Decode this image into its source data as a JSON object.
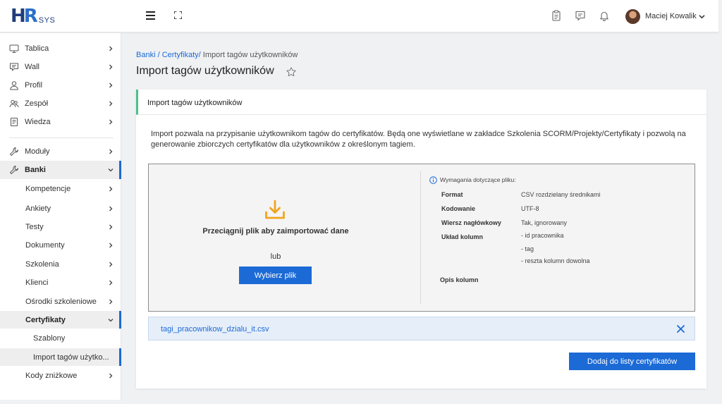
{
  "header": {
    "logo_main": "HR",
    "logo_sub": "SYS",
    "user_name": "Maciej Kowalik",
    "icons": [
      "menu-icon",
      "fullscreen-icon",
      "clipboard-icon",
      "chat-icon",
      "bell-icon",
      "chevron-down-icon"
    ]
  },
  "sidebar": {
    "items": [
      {
        "label": "Tablica",
        "icon": "monitor-icon"
      },
      {
        "label": "Wall",
        "icon": "chat-icon"
      },
      {
        "label": "Profil",
        "icon": "user-icon"
      },
      {
        "label": "Zespół",
        "icon": "team-icon"
      },
      {
        "label": "Wiedza",
        "icon": "book-icon"
      },
      {
        "label": "Moduły",
        "icon": "wrench-icon"
      },
      {
        "label": "Banki",
        "icon": "wrench-icon"
      },
      {
        "label": "Kompetencje"
      },
      {
        "label": "Ankiety"
      },
      {
        "label": "Testy"
      },
      {
        "label": "Dokumenty"
      },
      {
        "label": "Szkolenia"
      },
      {
        "label": "Klienci"
      },
      {
        "label": "Ośrodki szkoleniowe"
      },
      {
        "label": "Certyfikaty"
      },
      {
        "label": "Szablony"
      },
      {
        "label": "Import tagów użytko..."
      },
      {
        "label": "Kody zniżkowe"
      }
    ]
  },
  "breadcrumb": {
    "part1": "Banki",
    "sep1": " / ",
    "part2": "Certyfikaty",
    "sep2": "/ ",
    "current": "Import tagów użytkowników"
  },
  "page": {
    "title": "Import tagów użytkowników"
  },
  "card": {
    "header": "Import tagów użytkowników",
    "description": "Import pozwala na przypisanie użytkownikom tagów do certyfikatów. Będą one wyświetlane w zakładce Szkolenia SCORM/Projekty/Certyfikaty i pozwolą na generowanie zbiorczych certyfikatów dla użytkowników z określonym tagiem.",
    "drop": {
      "drag_text": "Przeciągnij plik aby zaimportować dane",
      "or_text": "lub",
      "choose_label": "Wybierz plik"
    },
    "requirements": {
      "title": "Wymagania dotyczące pliku:",
      "rows": [
        {
          "label": "Format",
          "value": "CSV rozdzielany średnikami"
        },
        {
          "label": "Kodowanie",
          "value": "UTF-8"
        },
        {
          "label": "Wiersz nagłówkowy",
          "value": "Tak, ignorowany"
        },
        {
          "label": "Układ kolumn",
          "value": "- id pracownika"
        }
      ],
      "extra_values": [
        "- tag",
        "- reszta kolumn dowolna"
      ],
      "opis_label": "Opis kolumn"
    },
    "file_name": "tagi_pracownikow_dzialu_it.csv",
    "submit_label": "Dodaj do listy certyfikatów"
  },
  "colors": {
    "primary": "#1b6ad6",
    "accent_green": "#4cc08a",
    "download_icon": "#f2a51c"
  }
}
